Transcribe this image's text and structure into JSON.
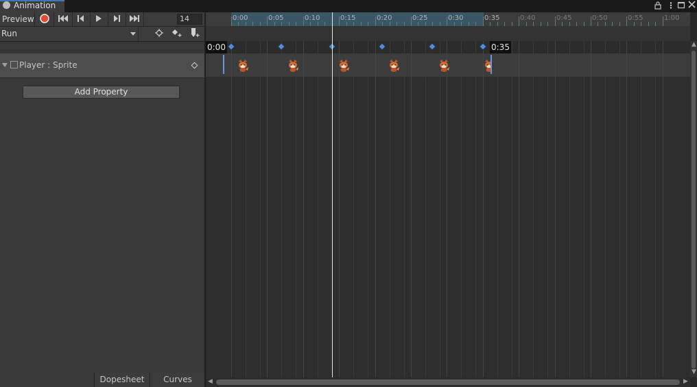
{
  "window": {
    "tab_title": "Animation",
    "icons": [
      "lock-icon",
      "kebab-menu-icon",
      "maximize-icon",
      "close-icon"
    ]
  },
  "toolbar": {
    "preview_label": "Preview",
    "frame_value": "14",
    "icons": [
      "record-icon",
      "first-keyframe-icon",
      "prev-keyframe-icon",
      "play-icon",
      "next-keyframe-icon",
      "last-keyframe-icon"
    ]
  },
  "clip": {
    "selected": "Run"
  },
  "keyframe_tools": {
    "icons": [
      "sample-crosshair-icon",
      "add-keyframe-icon",
      "add-event-icon"
    ]
  },
  "properties": {
    "items": [
      {
        "label": "Player : Sprite"
      }
    ],
    "add_button": "Add Property"
  },
  "tabs": {
    "dopesheet": "Dopesheet",
    "curves": "Curves"
  },
  "timeline": {
    "ticks": [
      "0:00",
      "0:05",
      "0:10",
      "0:15",
      "0:20",
      "0:25",
      "0:30",
      "0:35",
      "0:40",
      "0:45",
      "0:50",
      "0:55",
      "1:00"
    ],
    "start_time": "0:00",
    "end_time": "0:35",
    "current_frame": 14,
    "keyframes": [
      0,
      7,
      14,
      21,
      28,
      35
    ]
  },
  "colors": {
    "accent": "#3a79bb",
    "record": "#e04a32",
    "keyframe": "#5a8ad0",
    "range": "#3b5766"
  }
}
